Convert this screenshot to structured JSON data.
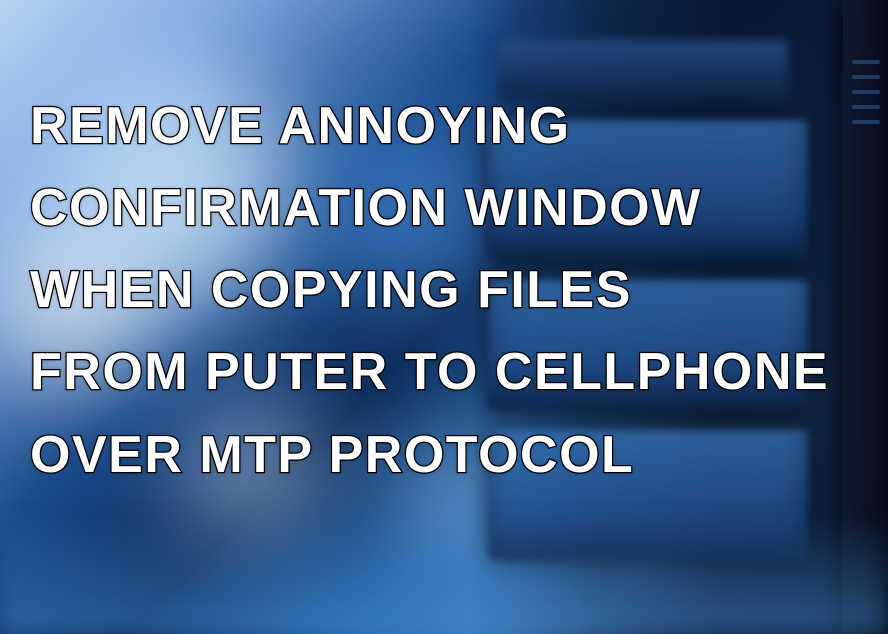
{
  "headline": {
    "text": "REMOVE ANNOYING\nCONFIRMATION WINDOW\nWHEN COPYING FILES\nFROM PUTER TO CELLPHONE\nOVER MTP PROTOCOL"
  }
}
